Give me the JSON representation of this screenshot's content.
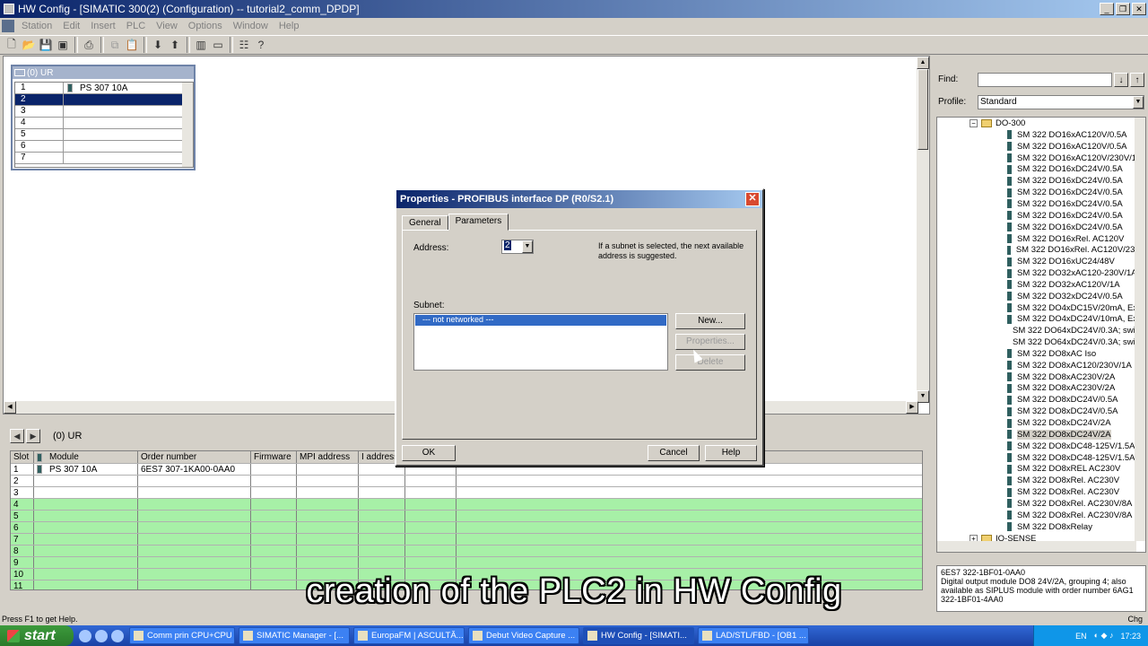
{
  "window": {
    "title": "HW Config - [SIMATIC 300(2) (Configuration) -- tutorial2_comm_DPDP]"
  },
  "menu": [
    "Station",
    "Edit",
    "Insert",
    "PLC",
    "View",
    "Options",
    "Window",
    "Help"
  ],
  "rack": {
    "title": "(0) UR",
    "rows": [
      {
        "slot": "1",
        "module": "PS 307 10A"
      },
      {
        "slot": "2",
        "module": ""
      },
      {
        "slot": "3",
        "module": ""
      },
      {
        "slot": "4",
        "module": ""
      },
      {
        "slot": "5",
        "module": ""
      },
      {
        "slot": "6",
        "module": ""
      },
      {
        "slot": "7",
        "module": ""
      }
    ]
  },
  "detail": {
    "title": "(0) UR",
    "columns": [
      "Slot",
      "Module",
      "Order number",
      "Firmware",
      "MPI address",
      "I address"
    ],
    "rows": [
      {
        "slot": "1",
        "module": "PS 307 10A",
        "order": "6ES7 307-1KA00-0AA0"
      },
      {
        "slot": "2",
        "module": "",
        "order": ""
      },
      {
        "slot": "3",
        "module": "",
        "order": ""
      },
      {
        "slot": "4",
        "module": "",
        "order": ""
      },
      {
        "slot": "5",
        "module": "",
        "order": ""
      },
      {
        "slot": "6",
        "module": "",
        "order": ""
      },
      {
        "slot": "7",
        "module": "",
        "order": ""
      },
      {
        "slot": "8",
        "module": "",
        "order": ""
      },
      {
        "slot": "9",
        "module": "",
        "order": ""
      },
      {
        "slot": "10",
        "module": "",
        "order": ""
      },
      {
        "slot": "11",
        "module": "",
        "order": ""
      }
    ]
  },
  "dialog": {
    "title": "Properties - PROFIBUS interface  DP (R0/S2.1)",
    "tabs": [
      "General",
      "Parameters"
    ],
    "address_label": "Address:",
    "address_value": "2",
    "hint": "If a subnet is selected, the next available address is suggested.",
    "subnet_label": "Subnet:",
    "subnet_items": [
      "--- not networked ---"
    ],
    "buttons": {
      "new": "New...",
      "properties": "Properties...",
      "delete": "Delete",
      "ok": "OK",
      "cancel": "Cancel",
      "help": "Help"
    }
  },
  "catalog": {
    "find_label": "Find:",
    "profile_label": "Profile:",
    "profile_value": "Standard",
    "folder_top": "DO-300",
    "folder_bottom": "IQ-SENSE",
    "items": [
      "SM 322 DO16xAC120V/0.5A",
      "SM 322 DO16xAC120V/0.5A",
      "SM 322 DO16xAC120V/230V/1A",
      "SM 322 DO16xDC24V/0.5A",
      "SM 322 DO16xDC24V/0.5A",
      "SM 322 DO16xDC24V/0.5A",
      "SM 322 DO16xDC24V/0.5A",
      "SM 322 DO16xDC24V/0.5A",
      "SM 322 DO16xDC24V/0.5A",
      "SM 322 DO16xRel. AC120V",
      "SM 322 DO16xRel. AC120V/230V",
      "SM 322 DO16xUC24/48V",
      "SM 322 DO32xAC120-230V/1A",
      "SM 322 DO32xAC120V/1A",
      "SM 322 DO32xDC24V/0.5A",
      "SM 322 DO4xDC15V/20mA, Ex",
      "SM 322 DO4xDC24V/10mA, Ex",
      "SM 322 DO64xDC24V/0.3A; switchi",
      "SM 322 DO64xDC24V/0.3A; switchi",
      "SM 322 DO8xAC Iso",
      "SM 322 DO8xAC120/230V/1A",
      "SM 322 DO8xAC230V/2A",
      "SM 322 DO8xAC230V/2A",
      "SM 322 DO8xDC24V/0.5A",
      "SM 322 DO8xDC24V/0.5A",
      "SM 322 DO8xDC24V/2A",
      "SM 322 DO8xDC24V/2A",
      "SM 322 DO8xDC48-125V/1.5A",
      "SM 322 DO8xDC48-125V/1.5A",
      "SM 322 DO8xREL AC230V",
      "SM 322 DO8xRel. AC230V",
      "SM 322 DO8xRel. AC230V",
      "SM 322 DO8xRel. AC230V/8A",
      "SM 322 DO8xRel. AC230V/8A",
      "SM 322 DO8xRelay"
    ],
    "description": "6ES7 322-1BF01-0AA0\nDigital output module DO8 24V/2A, grouping 4; also available as SIPLUS module with order number 6AG1 322-1BF01-4AA0"
  },
  "subtitle": "creation of the PLC2 in HW Config",
  "status": {
    "text": "Press F1 to get Help.",
    "right": "Chg"
  },
  "taskbar": {
    "start": "start",
    "tasks": [
      "Comm prin CPU+CPU ...",
      "SIMATIC Manager - [...",
      "EuropaFM | ASCULTĂ...",
      "Debut Video Capture ...",
      "HW Config - [SIMATI...",
      "LAD/STL/FBD - [OB1 ..."
    ],
    "lang": "EN",
    "clock": "17:23"
  }
}
